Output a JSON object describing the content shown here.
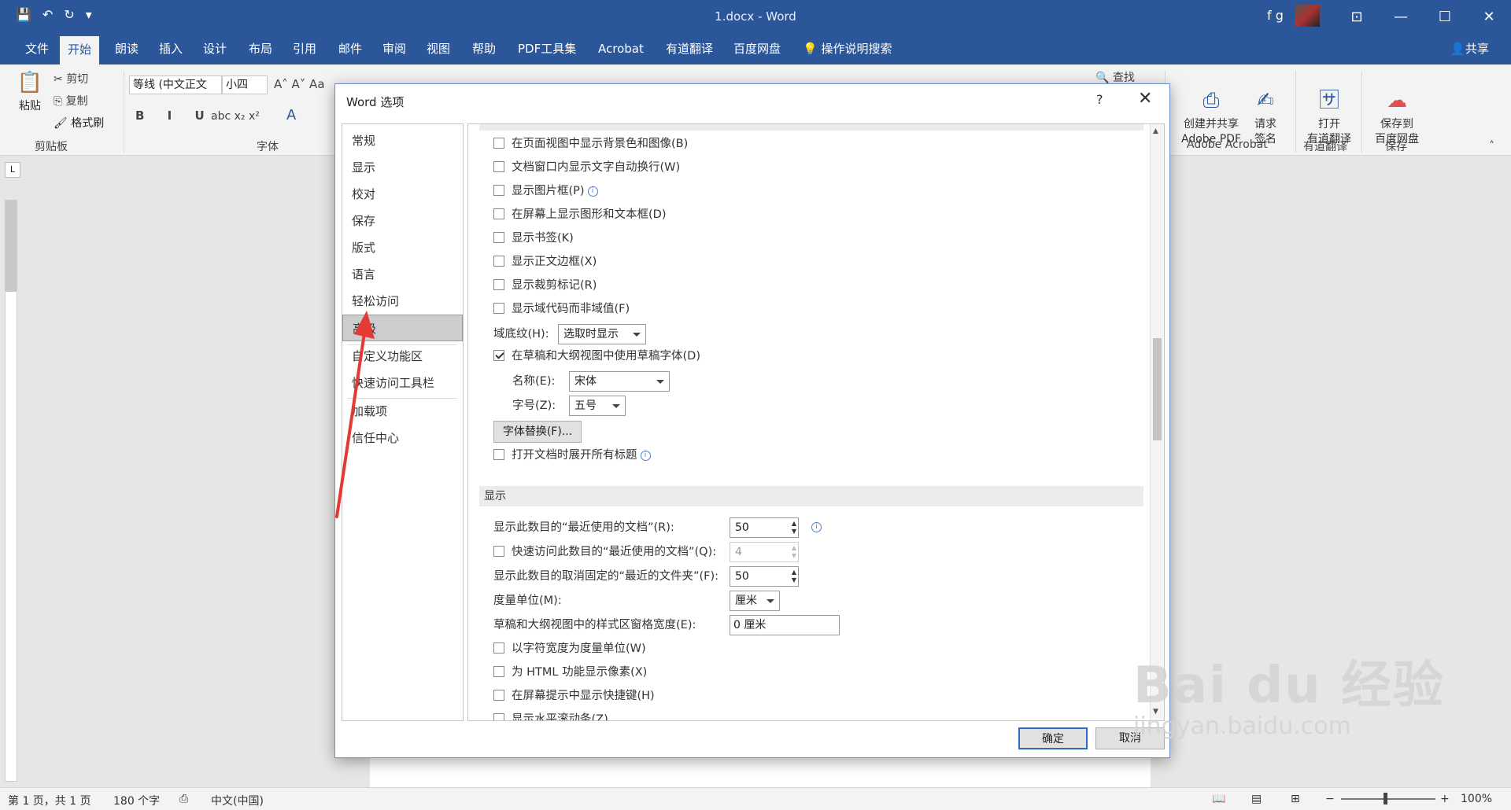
{
  "window": {
    "title": "1.docx  -  Word",
    "user": "f g",
    "controls": [
      "⊡",
      "—",
      "☐",
      "✕"
    ]
  },
  "tabs": [
    {
      "label": "文件"
    },
    {
      "label": "开始"
    },
    {
      "label": "朗读"
    },
    {
      "label": "插入"
    },
    {
      "label": "设计"
    },
    {
      "label": "布局"
    },
    {
      "label": "引用"
    },
    {
      "label": "邮件"
    },
    {
      "label": "审阅"
    },
    {
      "label": "视图"
    },
    {
      "label": "帮助"
    },
    {
      "label": "PDF工具集"
    },
    {
      "label": "Acrobat"
    },
    {
      "label": "有道翻译"
    },
    {
      "label": "百度网盘"
    }
  ],
  "tell_me": "操作说明搜索",
  "share": "共享",
  "ribbon": {
    "paste": "粘贴",
    "cut": "剪切",
    "copy": "复制",
    "format_painter": "格式刷",
    "clipboard_group": "剪贴板",
    "font_name": "等线 (中文正文",
    "font_size": "小四",
    "font_group": "字体",
    "find": "查找",
    "acrobat_create": "创建并共享\nAdobe PDF",
    "acrobat_sign": "请求\n签名",
    "acrobat_group": "Adobe Acrobat",
    "youdao_open": "打开\n有道翻译",
    "youdao_group": "有道翻译",
    "baidu_save": "保存到\n百度网盘",
    "baidu_group": "保存"
  },
  "dialog": {
    "title": "Word 选项",
    "help": "?",
    "close": "✕",
    "nav": [
      "常规",
      "显示",
      "校对",
      "保存",
      "版式",
      "语言",
      "轻松访问",
      "高级",
      "自定义功能区",
      "快速访问工具栏",
      "加载项",
      "信任中心"
    ],
    "selected_nav": "高级",
    "options_top": [
      {
        "label": "在页面视图中显示背景色和图像(B)",
        "checked": false
      },
      {
        "label": "文档窗口内显示文字自动换行(W)",
        "checked": false
      },
      {
        "label": "显示图片框(P)",
        "checked": false,
        "info": true
      },
      {
        "label": "在屏幕上显示图形和文本框(D)",
        "checked": false
      },
      {
        "label": "显示书签(K)",
        "checked": false
      },
      {
        "label": "显示正文边框(X)",
        "checked": false
      },
      {
        "label": "显示裁剪标记(R)",
        "checked": false
      },
      {
        "label": "显示域代码而非域值(F)",
        "checked": false
      }
    ],
    "field_shading_label": "域底纹(H):",
    "field_shading_value": "选取时显示",
    "draft_font": {
      "label": "在草稿和大纲视图中使用草稿字体(D)",
      "checked": true
    },
    "name_label": "名称(E):",
    "name_value": "宋体",
    "size_label": "字号(Z):",
    "size_value": "五号",
    "font_sub_button": "字体替换(F)...",
    "expand_headings": {
      "label": "打开文档时展开所有标题",
      "checked": false
    },
    "display_section": "显示",
    "recent_docs_label": "显示此数目的“最近使用的文档”(R):",
    "recent_docs_value": "50",
    "quick_access_label": "快速访问此数目的“最近使用的文档”(Q):",
    "quick_access_value": "4",
    "unpinned_label": "显示此数目的取消固定的“最近的文件夹”(F):",
    "unpinned_value": "50",
    "units_label": "度量单位(M):",
    "units_value": "厘米",
    "style_width_label": "草稿和大纲视图中的样式区窗格宽度(E):",
    "style_width_value": "0 厘米",
    "options_bottom": [
      {
        "label": "以字符宽度为度量单位(W)",
        "checked": false
      },
      {
        "label": "为 HTML 功能显示像素(X)",
        "checked": false
      },
      {
        "label": "在屏幕提示中显示快捷键(H)",
        "checked": false
      },
      {
        "label": "显示水平滚动条(Z)",
        "checked": false
      }
    ],
    "ok": "确定",
    "cancel": "取消"
  },
  "statusbar": {
    "page": "第 1 页，共 1 页",
    "words": "180 个字",
    "language": "中文(中国)",
    "zoom": "100%"
  },
  "watermark": {
    "brand": "Bai du 经验",
    "url": "jingyan.baidu.com"
  },
  "colors": {
    "accent": "#2b579a",
    "annotation": "#e53935"
  }
}
